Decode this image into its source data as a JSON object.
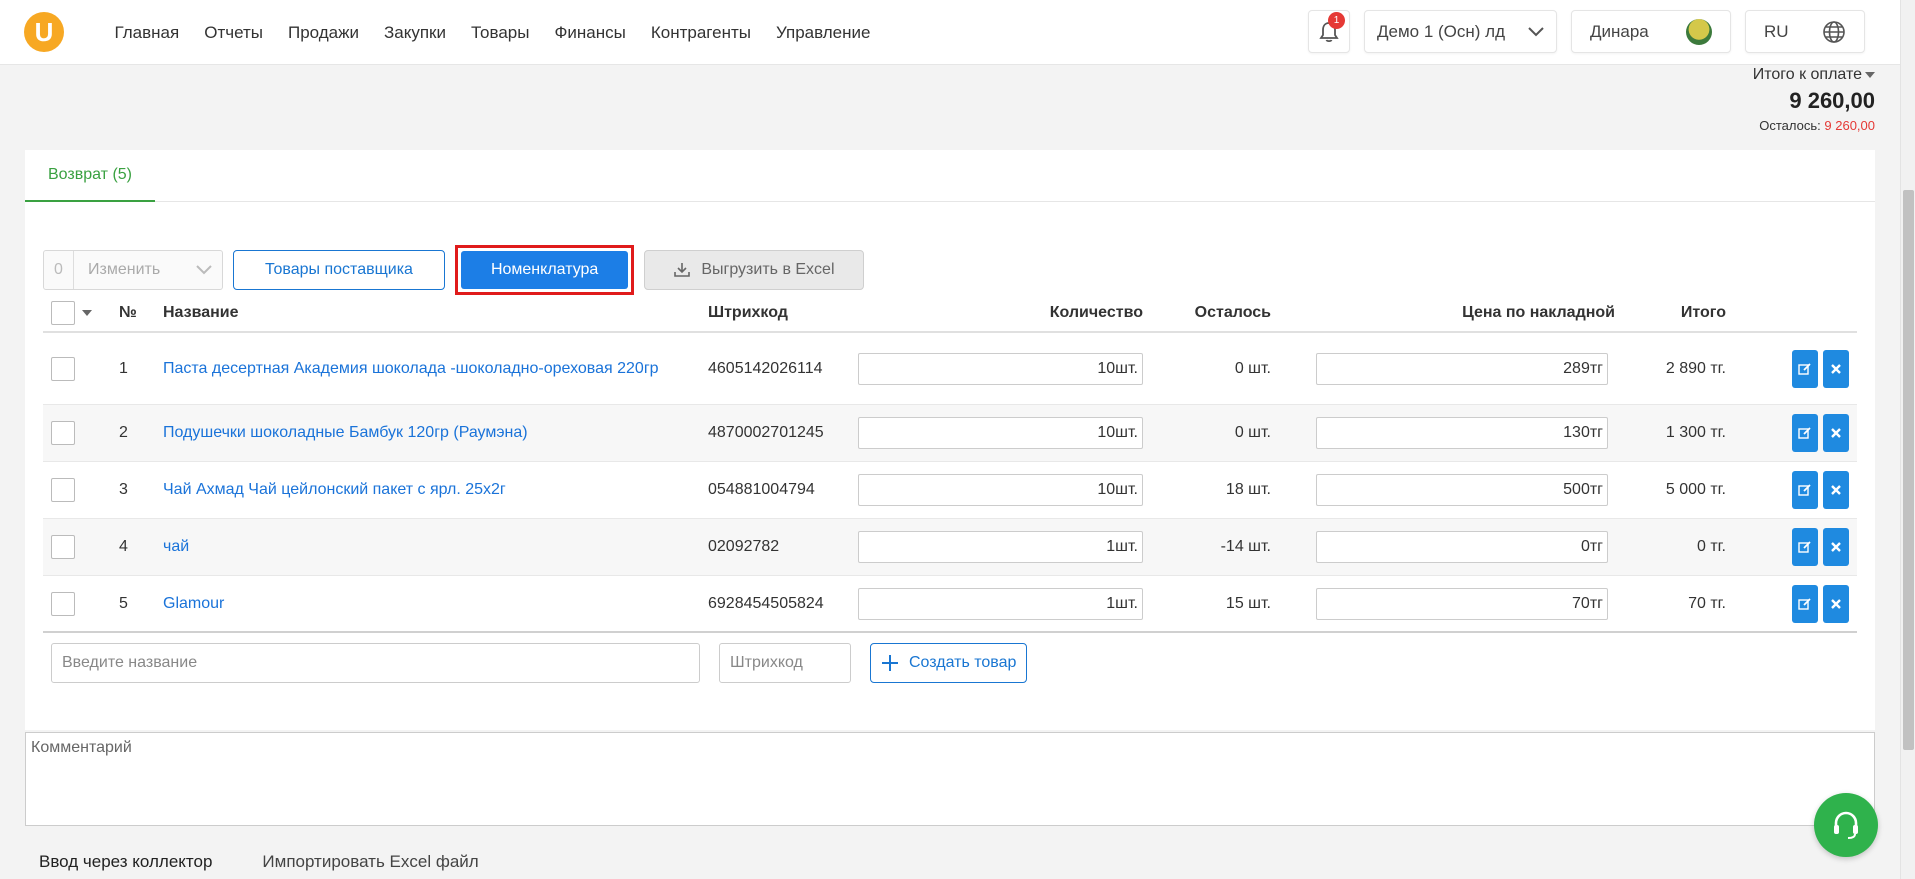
{
  "header": {
    "logo_letter": "U",
    "nav": [
      "Главная",
      "Отчеты",
      "Продажи",
      "Закупки",
      "Товары",
      "Финансы",
      "Контрагенты",
      "Управление"
    ],
    "notification_count": "1",
    "company": "Демо 1 (Осн) лд",
    "user": "Динара",
    "lang": "RU"
  },
  "totals": {
    "label": "Итого к оплате",
    "amount": "9 260,00",
    "left_label": "Осталось:",
    "left_value": "9 260,00"
  },
  "tab": {
    "label": "Возврат (5)"
  },
  "toolbar": {
    "count": "0",
    "change_label": "Изменить",
    "supplier_goods": "Товары поставщика",
    "nomenclature": "Номенклатура",
    "export_excel": "Выгрузить в Excel"
  },
  "table": {
    "headers": {
      "num": "№",
      "name": "Название",
      "barcode": "Штрихкод",
      "qty": "Количество",
      "left": "Осталось",
      "price": "Цена по накладной",
      "total": "Итого"
    },
    "rows": [
      {
        "num": "1",
        "name": "Паста десертная Академия шоколада -шоколадно-ореховая 220гр",
        "barcode": "4605142026114",
        "qty": "10шт.",
        "left": "0 шт.",
        "price": "289тг",
        "total": "2 890 тг."
      },
      {
        "num": "2",
        "name": "Подушечки шоколадные Бамбук 120гр (Раумэна)",
        "barcode": "4870002701245",
        "qty": "10шт.",
        "left": "0 шт.",
        "price": "130тг",
        "total": "1 300 тг."
      },
      {
        "num": "3",
        "name": "Чай Ахмад Чай цейлонский пакет с ярл. 25х2г",
        "barcode": "054881004794",
        "qty": "10шт.",
        "left": "18 шт.",
        "price": "500тг",
        "total": "5 000 тг."
      },
      {
        "num": "4",
        "name": "чай",
        "barcode": "02092782",
        "qty": "1шт.",
        "left": "-14 шт.",
        "price": "0тг",
        "total": "0 тг."
      },
      {
        "num": "5",
        "name": "Glamour",
        "barcode": "6928454505824",
        "qty": "1шт.",
        "left": "15 шт.",
        "price": "70тг",
        "total": "70 тг."
      }
    ]
  },
  "add_row": {
    "name_placeholder": "Введите название",
    "barcode_placeholder": "Штрихкод",
    "create_label": "Создать товар"
  },
  "comment": {
    "placeholder": "Комментарий"
  },
  "bottom_tabs": [
    "Ввод через коллектор",
    "Импортировать Excel файл"
  ],
  "colors": {
    "accent": "#1c7ee6",
    "green": "#3aa141",
    "red": "#e53935",
    "highlight": "#e01b1b"
  }
}
